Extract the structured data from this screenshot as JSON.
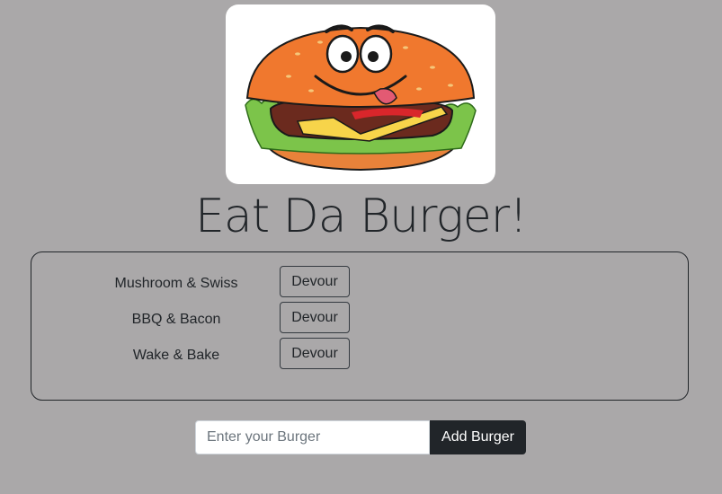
{
  "header": {
    "logo_icon": "cartoon-burger-icon",
    "title": "Eat Da Burger!"
  },
  "burgers": [
    {
      "name": "Mushroom & Swiss",
      "action_label": "Devour"
    },
    {
      "name": "BBQ & Bacon",
      "action_label": "Devour"
    },
    {
      "name": "Wake & Bake",
      "action_label": "Devour"
    }
  ],
  "form": {
    "input_placeholder": "Enter your Burger",
    "input_value": "",
    "submit_label": "Add Burger"
  },
  "colors": {
    "background": "#aaa8a9",
    "button_dark": "#212529",
    "text": "#212529"
  }
}
